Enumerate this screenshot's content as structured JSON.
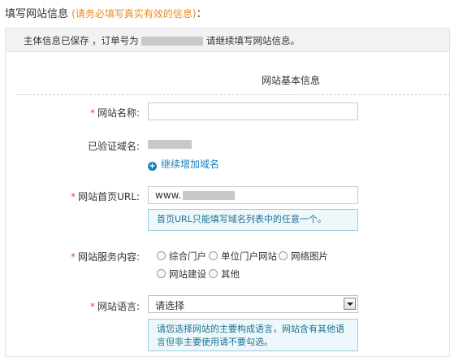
{
  "header": {
    "title": "填写网站信息",
    "note": "(请务必填写真实有效的信息)",
    "colon": "："
  },
  "notice": {
    "prefix": "主体信息已保存 ，订单号为",
    "suffix": "请继续填写网站信息。"
  },
  "section_title": "网站基本信息",
  "form": {
    "site_name": {
      "label": "网站名称:",
      "value": ""
    },
    "verified_domain": {
      "label": "已验证域名:"
    },
    "add_domain_link": "继续增加域名",
    "homepage_url": {
      "label": "网站首页URL:",
      "value": "www.",
      "hint": "首页URL只能填写域名列表中的任意一个。"
    },
    "service_content": {
      "label": "网站服务内容:",
      "options": [
        "综合门户",
        "单位门户网站",
        "网络图片",
        "网站建设",
        "其他"
      ]
    },
    "language": {
      "label": "网站语言:",
      "selected": "请选择",
      "hint": "请您选择网站的主要构成语言，网站含有其他语言但非主要使用请不要勾选。"
    }
  },
  "colors": {
    "accent": "#1a7fbf",
    "required": "#e64b3c",
    "note": "#f08a1c",
    "hint_bg": "#eef8fb",
    "hint_border": "#9ccfe0"
  }
}
